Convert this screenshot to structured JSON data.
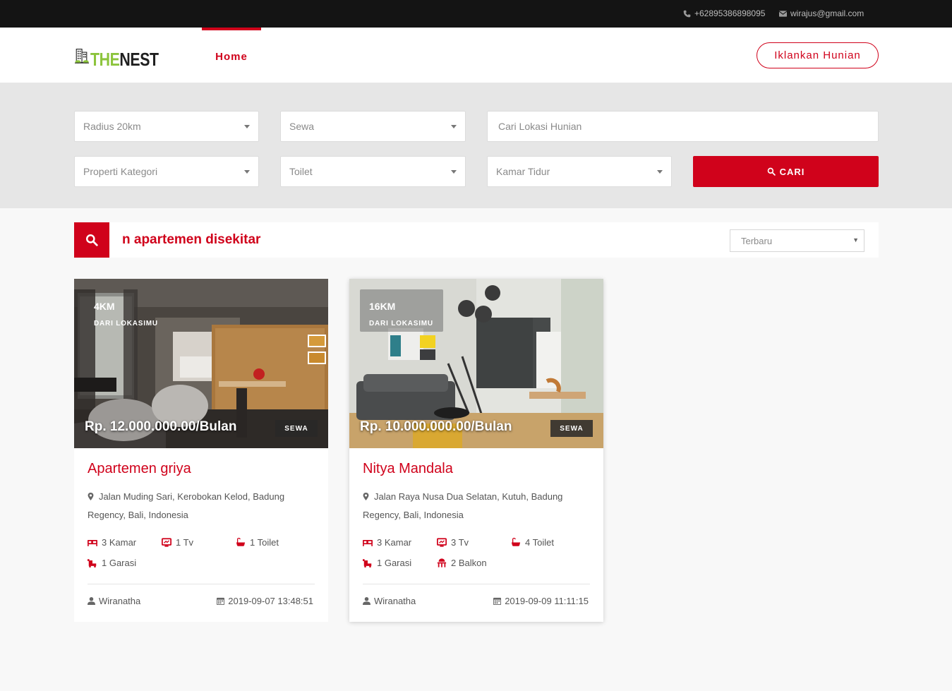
{
  "topbar": {
    "phone": "+62895386898095",
    "email": "wirajus@gmail.com"
  },
  "header": {
    "logo_the": "THE",
    "logo_nest": "NEST",
    "nav_home": "Home",
    "cta": "Iklankan Hunian"
  },
  "search": {
    "radius": "Radius 20km",
    "type": "Sewa",
    "location_placeholder": "Cari Lokasi Hunian",
    "category": "Properti Kategori",
    "toilet": "Toilet",
    "bedroom": "Kamar Tidur",
    "button": "CARI"
  },
  "results": {
    "marquee": "n apartemen disekitar",
    "sort": "Terbaru"
  },
  "listings": [
    {
      "distance": "4KM",
      "distance_label": "DARI LOKASIMU",
      "price": "Rp. 12.000.000.00/Bulan",
      "tag": "SEWA",
      "title": "Apartemen griya",
      "address": "Jalan Muding Sari, Kerobokan Kelod, Badung Regency, Bali, Indonesia",
      "features": {
        "kamar": "3 Kamar",
        "tv": "1 Tv",
        "toilet": "1 Toilet",
        "garasi": "1 Garasi"
      },
      "author": "Wiranatha",
      "date": "2019-09-07 13:48:51"
    },
    {
      "distance": "16KM",
      "distance_label": "DARI LOKASIMU",
      "price": "Rp. 10.000.000.00/Bulan",
      "tag": "SEWA",
      "title": "Nitya Mandala",
      "address": "Jalan Raya Nusa Dua Selatan, Kutuh, Badung Regency, Bali, Indonesia",
      "features": {
        "kamar": "3 Kamar",
        "tv": "3 Tv",
        "toilet": "4 Toilet",
        "garasi": "1 Garasi",
        "balkon": "2 Balkon"
      },
      "author": "Wiranatha",
      "date": "2019-09-09 11:11:15"
    }
  ],
  "colors": {
    "accent": "#d0021b",
    "topbar": "#141414",
    "logo_green": "#8cc43c",
    "panel": "#e6e6e6"
  }
}
